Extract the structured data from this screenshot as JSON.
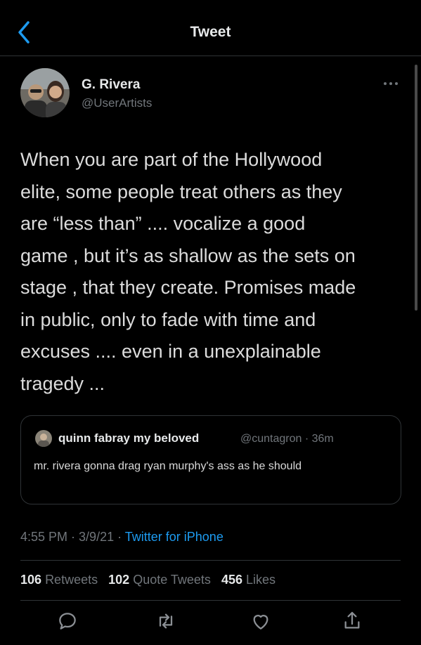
{
  "header": {
    "title": "Tweet"
  },
  "author": {
    "name": "G. Rivera",
    "handle": "@UserArtists"
  },
  "tweet": {
    "lines": [
      "When you are part of the Hollywood",
      "elite, some people treat others as they",
      "are “less than” .... vocalize a good",
      "game , but it’s as shallow as the sets on",
      "stage , that they create. Promises made",
      "in public, only to fade with time and",
      "excuses .... even in a unexplainable",
      "tragedy ..."
    ]
  },
  "quote": {
    "name": "quinn fabray my beloved",
    "handle": "@cuntagron",
    "time": "36m",
    "text": "mr. rivera gonna drag ryan murphy's ass as he should"
  },
  "meta": {
    "time": "4:55 PM",
    "date": "3/9/21",
    "source": "Twitter for iPhone"
  },
  "stats": {
    "retweets_count": "106",
    "retweets_label": "Retweets",
    "quotes_count": "102",
    "quotes_label": "Quote Tweets",
    "likes_count": "456",
    "likes_label": "Likes"
  },
  "icons": {
    "back": "chevron-left-icon",
    "more": "more-horizontal-icon",
    "reply": "reply-icon",
    "retweet": "retweet-icon",
    "like": "heart-icon",
    "share": "share-icon"
  },
  "colors": {
    "accent": "#1d9bf0",
    "background": "#000000",
    "secondary_text": "#71767b"
  }
}
